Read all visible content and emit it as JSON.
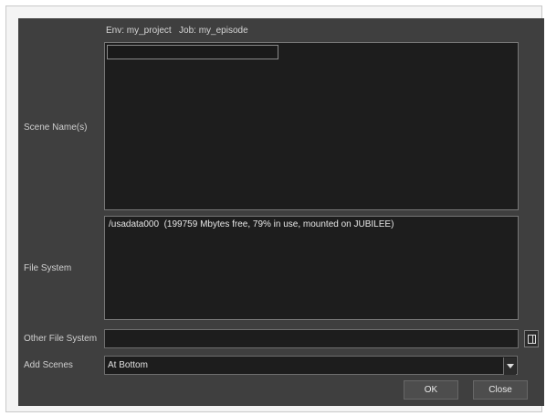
{
  "header": {
    "env_text": "Env: my_project   Job: my_episode"
  },
  "scene_names": {
    "label": "Scene Name(s)",
    "input_value": ""
  },
  "file_system": {
    "label": "File System",
    "entries": [
      "/usadata000  (199759 Mbytes free, 79% in use, mounted on JUBILEE)"
    ]
  },
  "other_file_system": {
    "label": "Other File System",
    "value": "",
    "browse_icon": "folder-browse-icon"
  },
  "add_scenes": {
    "label": "Add Scenes",
    "selected": "At Bottom",
    "dropdown_icon": "chevron-down-icon"
  },
  "buttons": {
    "ok": "OK",
    "close": "Close"
  }
}
